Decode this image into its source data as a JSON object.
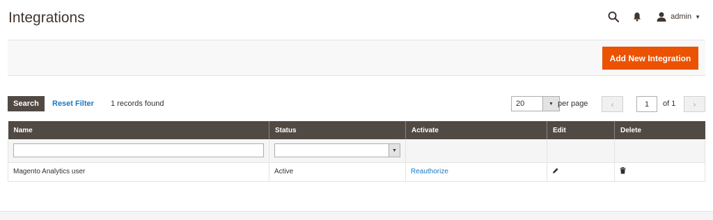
{
  "page": {
    "title": "Integrations"
  },
  "header": {
    "user_name": "admin"
  },
  "actions": {
    "add_new_label": "Add New Integration"
  },
  "toolbar": {
    "search_label": "Search",
    "reset_filter_label": "Reset Filter",
    "records_found": "1 records found",
    "per_page_value": "20",
    "per_page_label": "per page",
    "page_value": "1",
    "page_of": "of 1"
  },
  "grid": {
    "columns": [
      "Name",
      "Status",
      "Activate",
      "Edit",
      "Delete"
    ],
    "rows": [
      {
        "name": "Magento Analytics user",
        "status": "Active",
        "activate": "Reauthorize"
      }
    ]
  },
  "colors": {
    "accent": "#eb5202",
    "header_dark": "#514943",
    "link": "#1979c3"
  },
  "icons": [
    "search-icon",
    "bell-icon",
    "user-icon",
    "pencil-icon",
    "trash-icon"
  ]
}
